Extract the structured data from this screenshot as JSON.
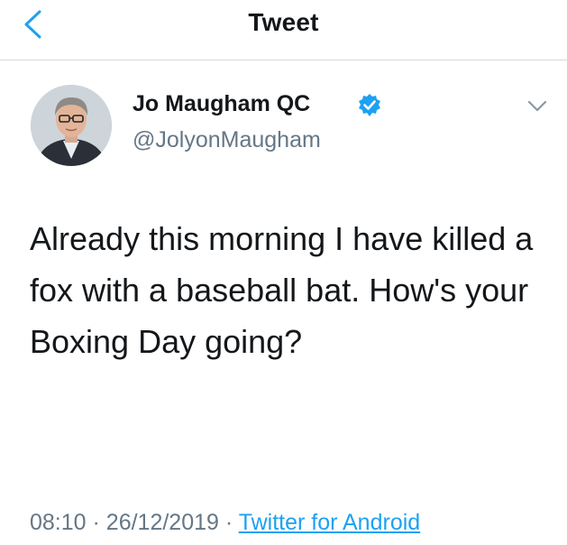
{
  "nav": {
    "back_icon": "chevron-left-icon",
    "title": "Tweet"
  },
  "tweet": {
    "author": {
      "display_name": "Jo Maugham QC",
      "handle": "@JolyonMaugham",
      "verified_icon": "verified-badge-icon",
      "avatar_icon": "avatar-photo"
    },
    "menu_icon": "chevron-down-icon",
    "text": "Already this morning I have killed a fox with a baseball bat. How's your Boxing Day going?",
    "time": "08:10",
    "date": "26/12/2019",
    "separator": "·",
    "source": "Twitter for Android"
  },
  "colors": {
    "accent": "#1da1f2",
    "secondary_text": "#657786",
    "primary_text": "#14171a",
    "divider": "#d8d8d8"
  }
}
